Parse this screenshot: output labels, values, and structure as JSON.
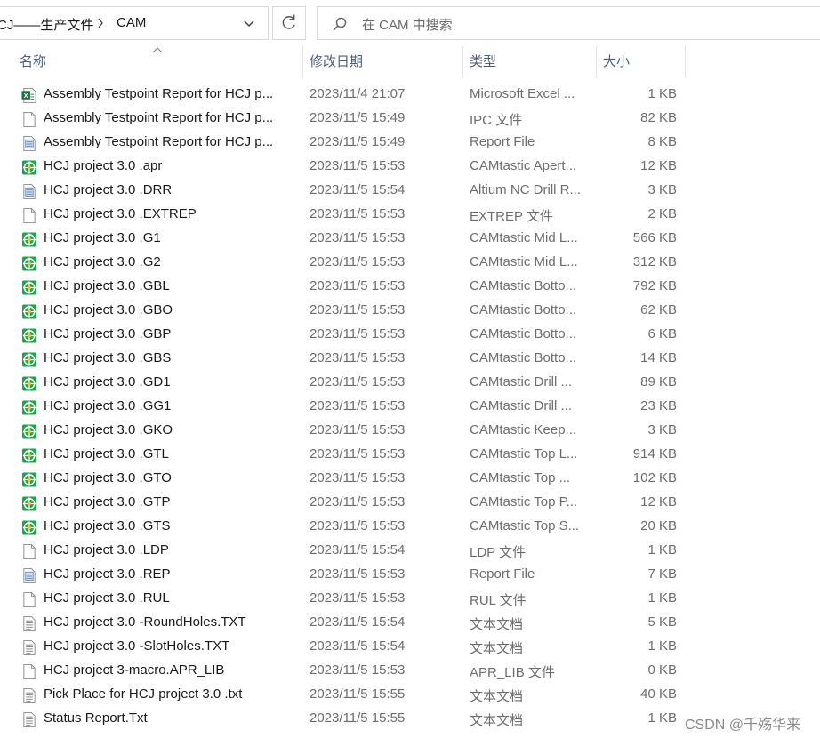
{
  "address_bar": {
    "crumbs": [
      "CJ——生产文件",
      "CAM"
    ],
    "separator_icon": "chevron-right-icon",
    "dropdown_icon": "chevron-down-icon"
  },
  "refresh_icon": "refresh-icon",
  "search": {
    "placeholder": "在 CAM 中搜索",
    "icon": "search-icon"
  },
  "columns": {
    "name": "名称",
    "date": "修改日期",
    "type": "类型",
    "size": "大小"
  },
  "sort": {
    "column": "name",
    "icon": "sort-up-icon"
  },
  "files": [
    {
      "name": "Assembly Testpoint Report for HCJ p...",
      "date": "2023/11/4 21:07",
      "type": "Microsoft Excel ...",
      "size": "1 KB",
      "icon": "excel-icon"
    },
    {
      "name": "Assembly Testpoint Report for HCJ p...",
      "date": "2023/11/5 15:49",
      "type": "IPC 文件",
      "size": "82 KB",
      "icon": "blank-file-icon"
    },
    {
      "name": "Assembly Testpoint Report for HCJ p...",
      "date": "2023/11/5 15:49",
      "type": "Report File",
      "size": "8 KB",
      "icon": "report-file-icon"
    },
    {
      "name": "HCJ project 3.0 .apr",
      "date": "2023/11/5 15:53",
      "type": "CAMtastic Apert...",
      "size": "12 KB",
      "icon": "camtastic-icon"
    },
    {
      "name": "HCJ project 3.0 .DRR",
      "date": "2023/11/5 15:54",
      "type": "Altium NC Drill R...",
      "size": "3 KB",
      "icon": "report-file-icon"
    },
    {
      "name": "HCJ project 3.0 .EXTREP",
      "date": "2023/11/5 15:53",
      "type": "EXTREP 文件",
      "size": "2 KB",
      "icon": "blank-file-icon"
    },
    {
      "name": "HCJ project 3.0 .G1",
      "date": "2023/11/5 15:53",
      "type": "CAMtastic Mid L...",
      "size": "566 KB",
      "icon": "camtastic-icon"
    },
    {
      "name": "HCJ project 3.0 .G2",
      "date": "2023/11/5 15:53",
      "type": "CAMtastic Mid L...",
      "size": "312 KB",
      "icon": "camtastic-icon"
    },
    {
      "name": "HCJ project 3.0 .GBL",
      "date": "2023/11/5 15:53",
      "type": "CAMtastic Botto...",
      "size": "792 KB",
      "icon": "camtastic-icon"
    },
    {
      "name": "HCJ project 3.0 .GBO",
      "date": "2023/11/5 15:53",
      "type": "CAMtastic Botto...",
      "size": "62 KB",
      "icon": "camtastic-icon"
    },
    {
      "name": "HCJ project 3.0 .GBP",
      "date": "2023/11/5 15:53",
      "type": "CAMtastic Botto...",
      "size": "6 KB",
      "icon": "camtastic-icon"
    },
    {
      "name": "HCJ project 3.0 .GBS",
      "date": "2023/11/5 15:53",
      "type": "CAMtastic Botto...",
      "size": "14 KB",
      "icon": "camtastic-icon"
    },
    {
      "name": "HCJ project 3.0 .GD1",
      "date": "2023/11/5 15:53",
      "type": "CAMtastic Drill ...",
      "size": "89 KB",
      "icon": "camtastic-icon"
    },
    {
      "name": "HCJ project 3.0 .GG1",
      "date": "2023/11/5 15:53",
      "type": "CAMtastic Drill ...",
      "size": "23 KB",
      "icon": "camtastic-icon"
    },
    {
      "name": "HCJ project 3.0 .GKO",
      "date": "2023/11/5 15:53",
      "type": "CAMtastic Keep...",
      "size": "3 KB",
      "icon": "camtastic-icon"
    },
    {
      "name": "HCJ project 3.0 .GTL",
      "date": "2023/11/5 15:53",
      "type": "CAMtastic Top L...",
      "size": "914 KB",
      "icon": "camtastic-icon"
    },
    {
      "name": "HCJ project 3.0 .GTO",
      "date": "2023/11/5 15:53",
      "type": "CAMtastic Top ...",
      "size": "102 KB",
      "icon": "camtastic-icon"
    },
    {
      "name": "HCJ project 3.0 .GTP",
      "date": "2023/11/5 15:53",
      "type": "CAMtastic Top P...",
      "size": "12 KB",
      "icon": "camtastic-icon"
    },
    {
      "name": "HCJ project 3.0 .GTS",
      "date": "2023/11/5 15:53",
      "type": "CAMtastic Top S...",
      "size": "20 KB",
      "icon": "camtastic-icon"
    },
    {
      "name": "HCJ project 3.0 .LDP",
      "date": "2023/11/5 15:54",
      "type": "LDP 文件",
      "size": "1 KB",
      "icon": "blank-file-icon"
    },
    {
      "name": "HCJ project 3.0 .REP",
      "date": "2023/11/5 15:53",
      "type": "Report File",
      "size": "7 KB",
      "icon": "report-file-icon"
    },
    {
      "name": "HCJ project 3.0 .RUL",
      "date": "2023/11/5 15:53",
      "type": "RUL 文件",
      "size": "1 KB",
      "icon": "blank-file-icon"
    },
    {
      "name": "HCJ project 3.0 -RoundHoles.TXT",
      "date": "2023/11/5 15:54",
      "type": "文本文档",
      "size": "5 KB",
      "icon": "text-file-icon"
    },
    {
      "name": "HCJ project 3.0 -SlotHoles.TXT",
      "date": "2023/11/5 15:54",
      "type": "文本文档",
      "size": "1 KB",
      "icon": "text-file-icon"
    },
    {
      "name": "HCJ project 3-macro.APR_LIB",
      "date": "2023/11/5 15:53",
      "type": "APR_LIB 文件",
      "size": "0 KB",
      "icon": "blank-file-icon"
    },
    {
      "name": "Pick Place for HCJ project 3.0 .txt",
      "date": "2023/11/5 15:55",
      "type": "文本文档",
      "size": "40 KB",
      "icon": "text-file-icon"
    },
    {
      "name": "Status Report.Txt",
      "date": "2023/11/5 15:55",
      "type": "文本文档",
      "size": "1 KB",
      "icon": "text-file-icon"
    }
  ],
  "watermark": "CSDN @千殇华来",
  "colors": {
    "camtastic_green": "#1fa34a",
    "excel_green": "#1d7044",
    "header_text": "#4c607a"
  }
}
